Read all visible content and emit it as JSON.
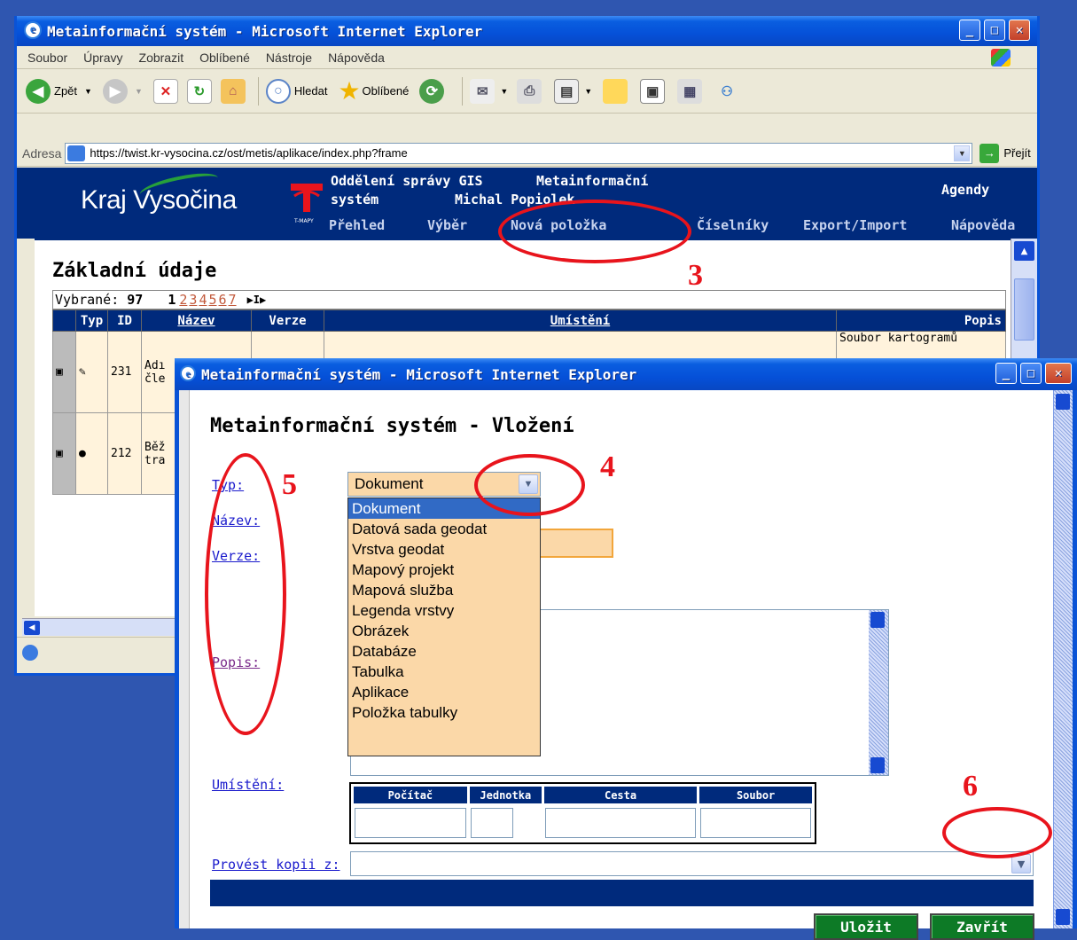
{
  "main_window": {
    "title": "Metainformační systém - Microsoft Internet Explorer",
    "menu": [
      "Soubor",
      "Úpravy",
      "Zobrazit",
      "Oblíbené",
      "Nástroje",
      "Nápověda"
    ],
    "toolbar": {
      "back": "Zpět",
      "search": "Hledat",
      "favorites": "Oblíbené"
    },
    "address_label": "Adresa",
    "address_url": "https://twist.kr-vysocina.cz/ost/metis/aplikace/index.php?frame",
    "go_label": "Přejít"
  },
  "site_header": {
    "brand": "Kraj Vysočina",
    "department_line1": "Oddělení správy GIS",
    "department_line2": "systém",
    "system_line1": "Metainformační",
    "user": "Michal Popiolek",
    "agendy": "Agendy",
    "logo_caption": "T-MAPY",
    "nav": [
      "Přehled",
      "Výběr",
      "Nová položka",
      "Číselníky",
      "Export/Import",
      "Nápověda"
    ]
  },
  "content": {
    "heading": "Základní údaje",
    "selected_label": "Vybrané:",
    "selected_count": "97",
    "current_page": "1",
    "pages": [
      "2",
      "3",
      "4",
      "5",
      "6",
      "7"
    ],
    "pager_arrows": "▶I▶",
    "columns": [
      "",
      "Typ",
      "ID",
      "Název",
      "Verze",
      "Umístění",
      "Popis"
    ],
    "rows": [
      {
        "id": "231",
        "name_line1": "Adı",
        "name_line2": "čle",
        "popis": "Soubor kartogramů"
      },
      {
        "id": "212",
        "name_line1": "Běž",
        "name_line2": "tra",
        "popis": ""
      }
    ]
  },
  "dialog": {
    "title": "Metainformační systém - Microsoft Internet Explorer",
    "heading": "Metainformační systém - Vložení",
    "labels": {
      "typ": "Typ:",
      "nazev": "Název:",
      "verze": "Verze:",
      "popis": "Popis:",
      "umisteni": "Umístění:",
      "kopie": "Provést kopii z:"
    },
    "typ_selected": "Dokument",
    "typ_options": [
      "Dokument",
      "Datová sada geodat",
      "Vrstva geodat",
      "Mapový projekt",
      "Mapová služba",
      "Legenda vrstvy",
      "Obrázek",
      "Databáze",
      "Tabulka",
      "Aplikace",
      "Položka tabulky"
    ],
    "umisteni_columns": [
      "Počítač",
      "Jednotka",
      "Cesta",
      "Soubor"
    ],
    "save_label": "Uložit",
    "close_label": "Zavřít"
  },
  "annotations": [
    "3",
    "4",
    "5",
    "6"
  ],
  "colors": {
    "annotation": "#e8141c",
    "site_blue": "#002a7c",
    "field_orange": "#fbd8a8",
    "button_green": "#0d7a26"
  }
}
